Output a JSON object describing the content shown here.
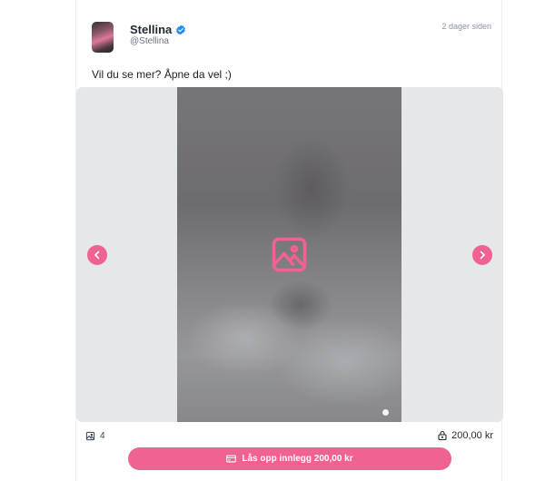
{
  "post": {
    "author": {
      "name": "Stellina",
      "handle": "@Stellina",
      "verified": true
    },
    "timestamp": "2 dager siden",
    "caption": "Vil du se mer? Åpne da vel ;)",
    "media": {
      "icon": "image-placeholder-icon",
      "slides_total": 1,
      "active_slide": 1
    },
    "media_count": "4",
    "price": "200,00 kr",
    "unlock_label": "Lås opp innlegg 200,00 kr"
  },
  "colors": {
    "accent": "#f06292",
    "verified": "#1d8cf8",
    "media_bg": "#e5e7eb"
  }
}
